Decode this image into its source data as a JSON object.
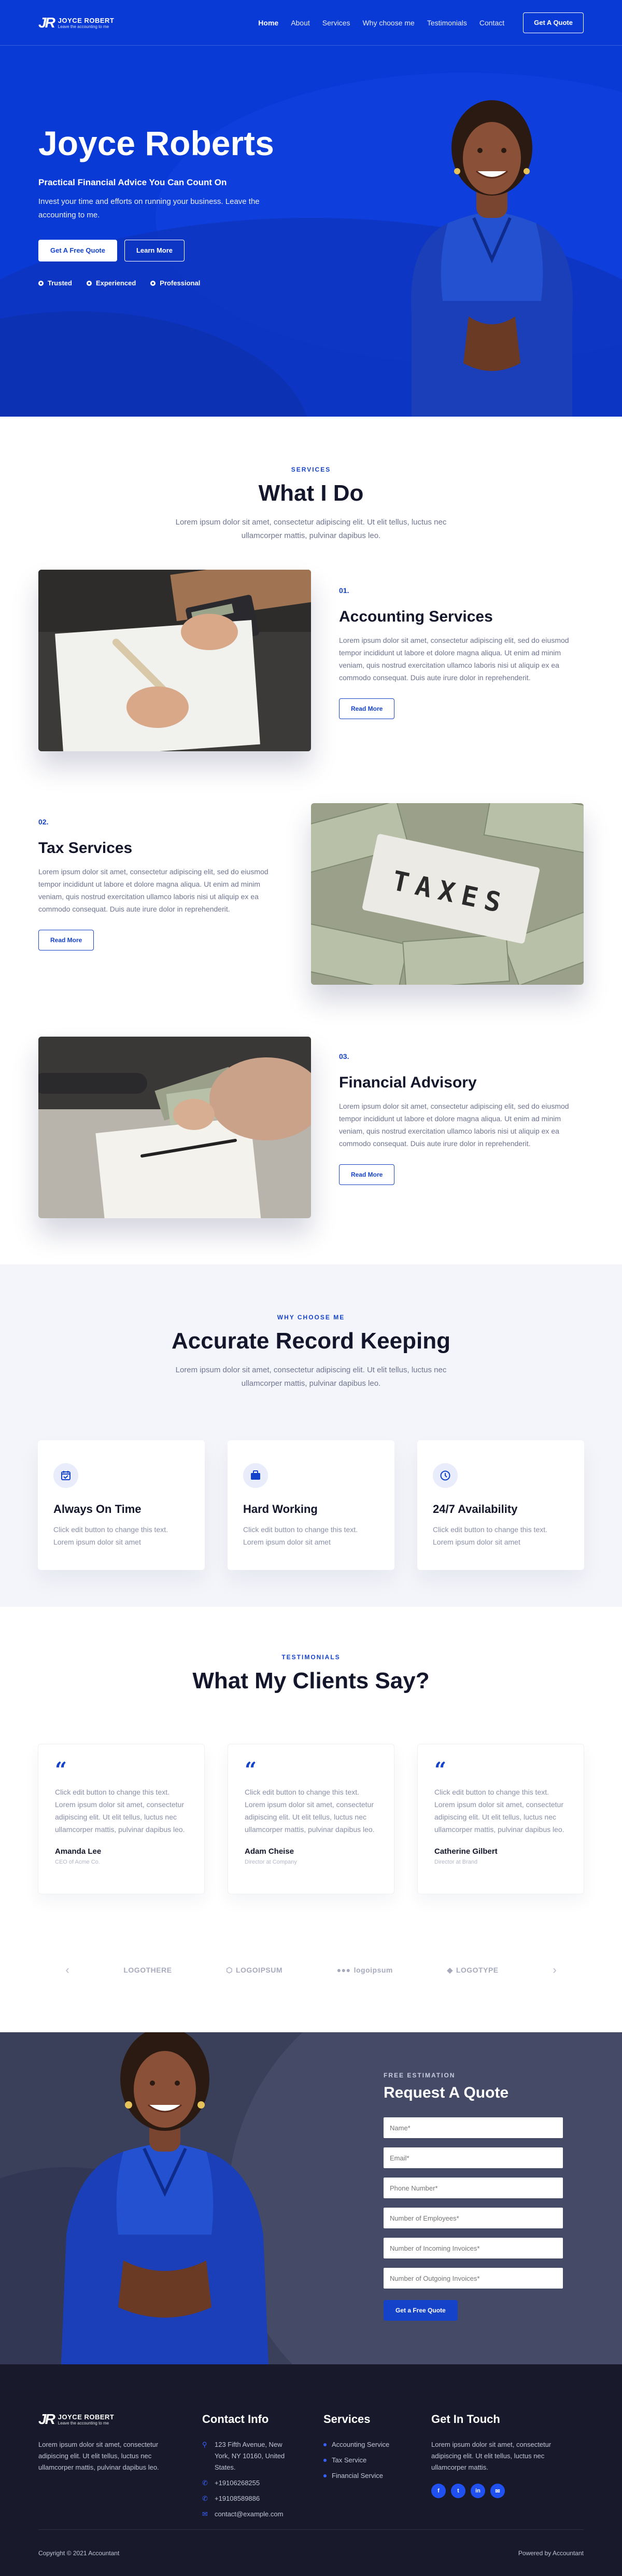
{
  "brand": {
    "name": "JOYCE ROBERT",
    "tagline": "Leave the accounting to me",
    "mark": "JR"
  },
  "nav": {
    "items": [
      "Home",
      "About",
      "Services",
      "Why choose me",
      "Testimonials",
      "Contact"
    ],
    "cta": "Get A Quote"
  },
  "hero": {
    "name": "Joyce Roberts",
    "tagline": "Practical Financial Advice You Can Count On",
    "text": "Invest your time and efforts on running your business. Leave the accounting to me.",
    "btn_primary": "Get A Free Quote",
    "btn_secondary": "Learn More",
    "badges": [
      "Trusted",
      "Experienced",
      "Professional"
    ]
  },
  "services": {
    "eyebrow": "Services",
    "title": "What I Do",
    "subtitle": "Lorem ipsum dolor sit amet, consectetur adipiscing elit. Ut elit tellus, luctus nec ullamcorper mattis, pulvinar dapibus leo.",
    "items": [
      {
        "num": "01.",
        "title": "Accounting Services",
        "text": "Lorem ipsum dolor sit amet, consectetur adipiscing elit, sed do eiusmod tempor incididunt ut labore et dolore magna aliqua. Ut enim ad minim veniam, quis nostrud exercitation ullamco laboris nisi ut aliquip ex ea commodo consequat. Duis aute irure dolor in reprehenderit.",
        "btn": "Read More"
      },
      {
        "num": "02.",
        "title": "Tax Services",
        "text": "Lorem ipsum dolor sit amet, consectetur adipiscing elit, sed do eiusmod tempor incididunt ut labore et dolore magna aliqua. Ut enim ad minim veniam, quis nostrud exercitation ullamco laboris nisi ut aliquip ex ea commodo consequat. Duis aute irure dolor in reprehenderit.",
        "btn": "Read More"
      },
      {
        "num": "03.",
        "title": "Financial Advisory",
        "text": "Lorem ipsum dolor sit amet, consectetur adipiscing elit, sed do eiusmod tempor incididunt ut labore et dolore magna aliqua. Ut enim ad minim veniam, quis nostrud exercitation ullamco laboris nisi ut aliquip ex ea commodo consequat. Duis aute irure dolor in reprehenderit.",
        "btn": "Read More"
      }
    ],
    "taxes_sign": "TAXES"
  },
  "why": {
    "eyebrow": "Why choose me",
    "title": "Accurate Record Keeping",
    "subtitle": "Lorem ipsum dolor sit amet, consectetur adipiscing elit. Ut elit tellus, luctus nec ullamcorper mattis, pulvinar dapibus leo.",
    "cards": [
      {
        "icon": "calendar-check-icon",
        "title": "Always On Time",
        "text": "Click edit button to change this text. Lorem ipsum dolor sit amet"
      },
      {
        "icon": "briefcase-icon",
        "title": "Hard Working",
        "text": "Click edit button to change this text. Lorem ipsum dolor sit amet"
      },
      {
        "icon": "clock-icon",
        "title": "24/7 Availability",
        "text": "Click edit button to change this text. Lorem ipsum dolor sit amet"
      }
    ]
  },
  "testimonials": {
    "eyebrow": "Testimonials",
    "title": "What My Clients Say?",
    "items": [
      {
        "text": "Click edit button to change this text. Lorem ipsum dolor sit amet, consectetur adipiscing elit. Ut elit tellus, luctus nec ullamcorper mattis, pulvinar dapibus leo.",
        "name": "Amanda Lee",
        "role": "CEO of Acme Co."
      },
      {
        "text": "Click edit button to change this text. Lorem ipsum dolor sit amet, consectetur adipiscing elit. Ut elit tellus, luctus nec ullamcorper mattis, pulvinar dapibus leo.",
        "name": "Adam Cheise",
        "role": "Director at Company"
      },
      {
        "text": "Click edit button to change this text. Lorem ipsum dolor sit amet, consectetur adipiscing elit. Ut elit tellus, luctus nec ullamcorper mattis, pulvinar dapibus leo.",
        "name": "Catherine Gilbert",
        "role": "Director at Brand"
      }
    ],
    "logos": [
      "LOGOTHERE",
      "LOGOIPSUM",
      "logoipsum",
      "LOGOTYPE"
    ]
  },
  "quote": {
    "eyebrow": "Free Estimation",
    "title": "Request A Quote",
    "fields": [
      "Name*",
      "Email*",
      "Phone Number*",
      "Number of Employees*",
      "Number of Incoming Invoices*",
      "Number of Outgoing Invoices*"
    ],
    "btn": "Get a Free Quote"
  },
  "footer": {
    "about": "Lorem ipsum dolor sit amet, consectetur adipiscing elit. Ut elit tellus, luctus nec ullamcorper mattis, pulvinar dapibus leo.",
    "contact_title": "Contact Info",
    "contact": [
      "123 Fifth Avenue, New York, NY 10160, United States.",
      "+19106268255",
      "+19108589886",
      "contact@example.com"
    ],
    "services_title": "Services",
    "services": [
      "Accounting Service",
      "Tax Service",
      "Financial Service"
    ],
    "touch_title": "Get In Touch",
    "touch_text": "Lorem ipsum dolor sit amet, consectetur adipiscing elit. Ut elit tellus, luctus nec ullamcorper mattis.",
    "social": [
      "f",
      "t",
      "in",
      "✉"
    ],
    "copyright": "Copyright © 2021 Accountant",
    "powered": "Powered by Accountant"
  },
  "colors": {
    "primary": "#1442c8",
    "hero_bg": "#0a3ad6",
    "footer_bg": "#181a2b",
    "quote_bg": "#3a3f5a"
  }
}
